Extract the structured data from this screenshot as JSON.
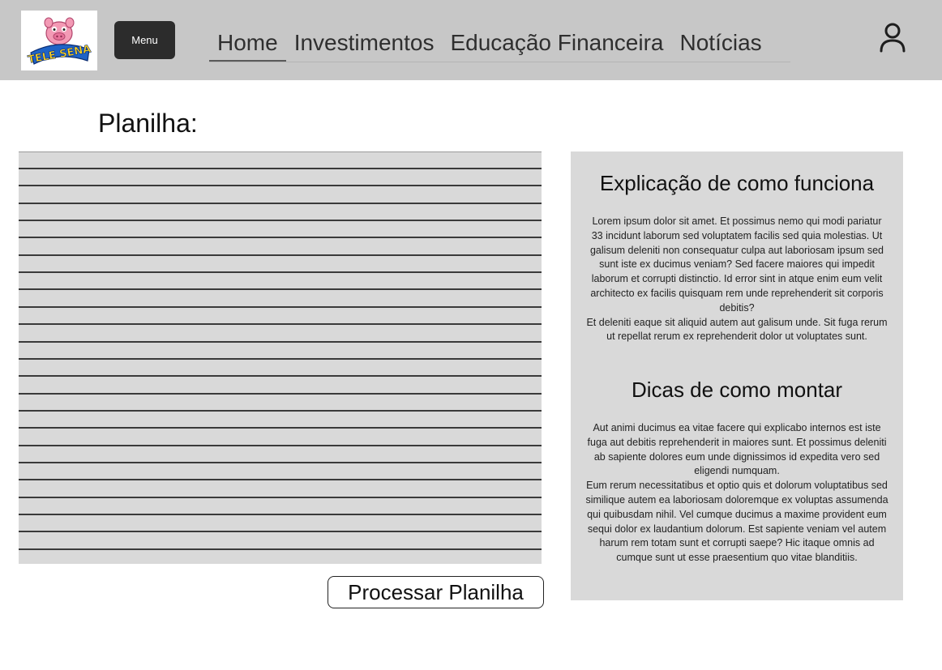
{
  "header": {
    "logo_text": "TELE SENA",
    "menu_label": "Menu",
    "nav": [
      {
        "label": "Home",
        "active": true
      },
      {
        "label": "Investimentos",
        "active": false
      },
      {
        "label": "Educação Financeira",
        "active": false
      },
      {
        "label": "Notícias",
        "active": false
      }
    ],
    "user_icon": "user-icon"
  },
  "main": {
    "sheet_title": "Planilha:",
    "sheet_rows": 23,
    "process_button": "Processar Planilha"
  },
  "sidebar": {
    "how_title": "Explicação de como funciona",
    "how_text": "Lorem ipsum dolor sit amet. Et possimus nemo qui modi pariatur 33 incidunt laborum sed voluptatem facilis sed quia molestias. Ut galisum deleniti non consequatur culpa aut laboriosam ipsum sed sunt iste ex ducimus veniam? Sed facere maiores qui impedit laborum et corrupti distinctio. Id error sint in atque enim eum velit architecto ex facilis quisquam rem unde reprehenderit sit corporis debitis?\nEt deleniti eaque sit aliquid autem aut galisum unde. Sit fuga rerum ut repellat rerum ex reprehenderit dolor ut voluptates sunt.",
    "tips_title": "Dicas de como montar",
    "tips_text": "Aut animi ducimus ea vitae facere qui explicabo internos est iste fuga aut debitis reprehenderit in maiores sunt. Et possimus deleniti ab sapiente dolores eum unde dignissimos id expedita vero sed eligendi numquam.\nEum rerum necessitatibus et optio quis et dolorum voluptatibus sed similique autem ea laboriosam doloremque ex voluptas assumenda qui quibusdam nihil. Vel cumque ducimus a maxime provident eum sequi dolor ex laudantium dolorum. Est sapiente veniam vel autem harum rem totam sunt et corrupti saepe? Hic itaque omnis ad cumque sunt ut esse praesentium quo vitae blanditiis."
  },
  "colors": {
    "header_bg": "#c7c7c7",
    "panel_bg": "#d9d9d9",
    "menu_bg": "#2c2c2c"
  }
}
